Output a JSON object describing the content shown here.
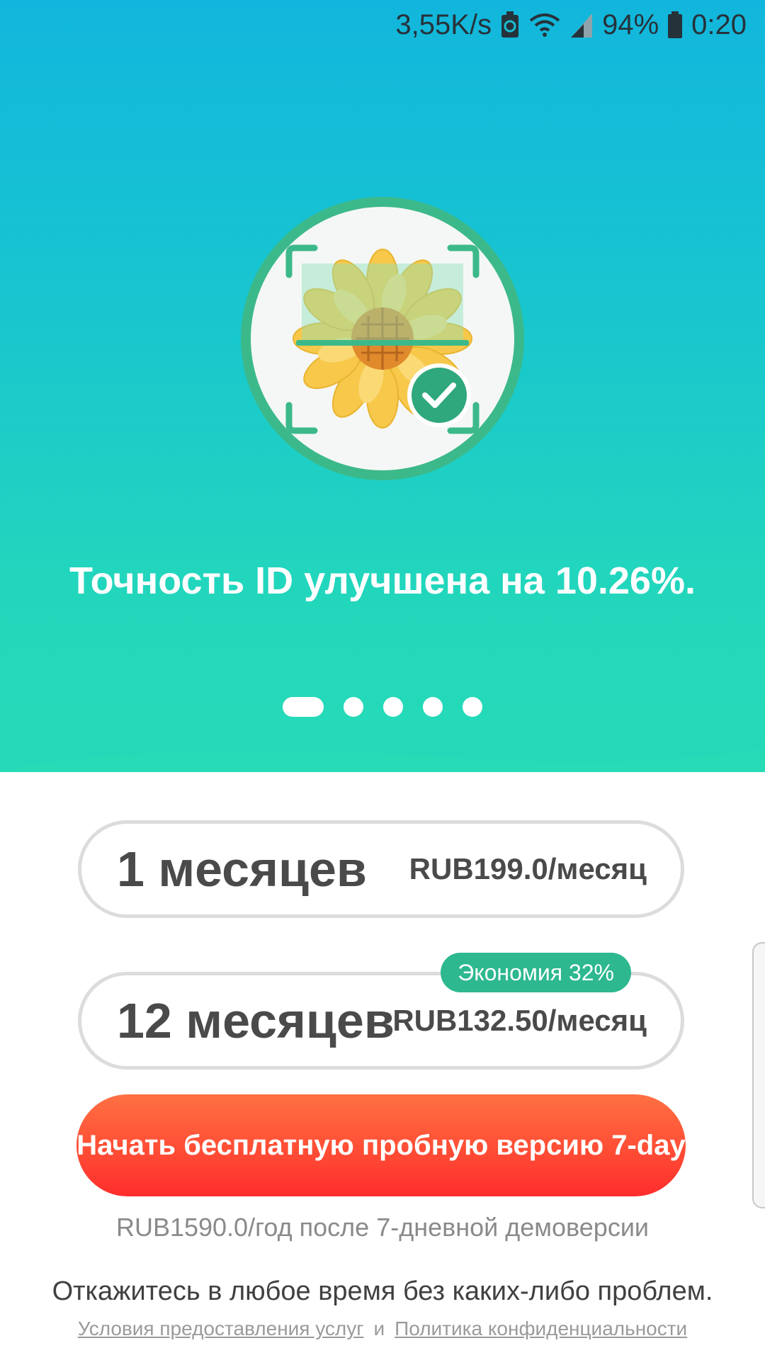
{
  "status_bar": {
    "speed": "3,55K/s",
    "battery_percent": "94%",
    "time": "0:20",
    "icons": [
      "recycle-battery-icon",
      "wifi-icon",
      "signal-icon",
      "battery-icon"
    ]
  },
  "hero": {
    "illustration": "sunflower-scan-check-illustration",
    "headline": "Точность ID улучшена на 10.26%.",
    "pager": {
      "count": 5,
      "active_index": 0
    }
  },
  "plans": [
    {
      "name": "1 месяцев",
      "price": "RUB199.0/месяц",
      "badge": ""
    },
    {
      "name": "12 месяцев",
      "price": "RUB132.50/месяц",
      "badge": "Экономия 32%"
    }
  ],
  "cta": {
    "label": "Начать бесплатную пробную версию 7-day"
  },
  "price_note": "RUB1590.0/год после 7-дневной демоверсии",
  "cancel_note": "Откажитесь в любое время без каких-либо проблем.",
  "links": {
    "terms": "Условия предоставления услуг",
    "and": "и",
    "privacy": "Политика конфиденциальности"
  },
  "colors": {
    "gradient_top": "#12b6dc",
    "gradient_bottom": "#26dbb6",
    "accent_green": "#2db88f",
    "cta_red": "#ff3a30"
  }
}
